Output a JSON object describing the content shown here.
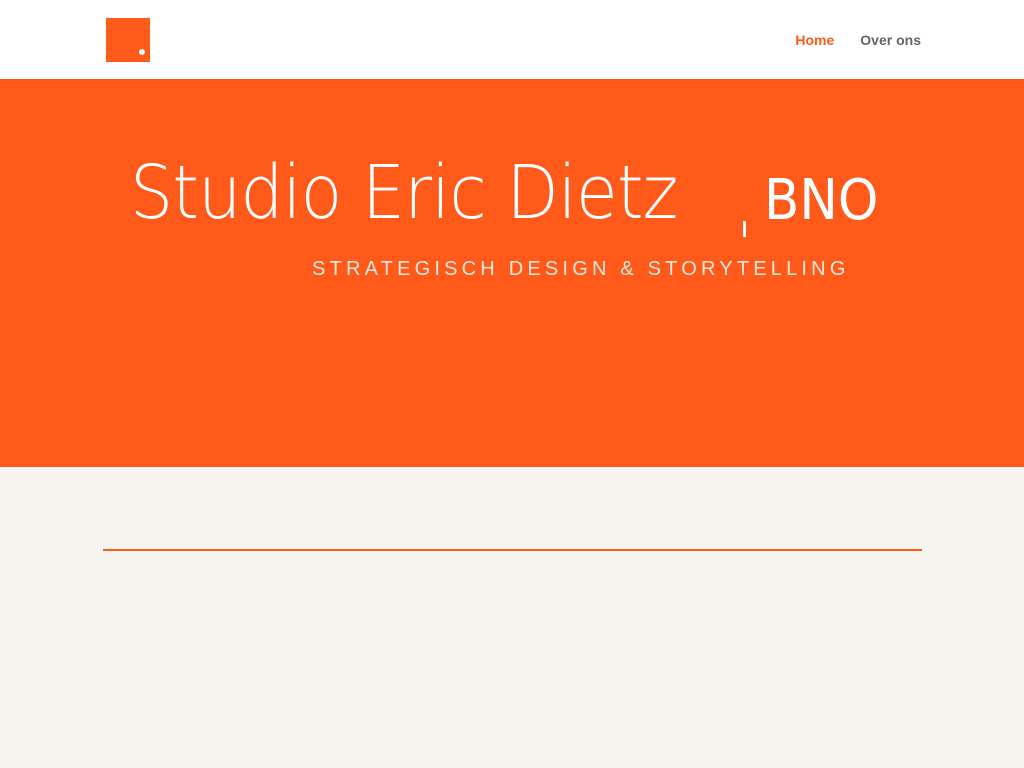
{
  "colors": {
    "brand_orange": "#ff5a1a",
    "page_background": "#f5f4ee",
    "header_background": "#ffffff",
    "nav_text": "#666666"
  },
  "header": {
    "logo_icon": "orange-square-dot-logo",
    "nav": [
      {
        "label": "Home",
        "active": true
      },
      {
        "label": "Over ons",
        "active": false
      }
    ]
  },
  "hero": {
    "title": "Studio Eric Dietz",
    "separator": ",",
    "suffix": "BNO",
    "subtitle": "STRATEGISCH DESIGN & STORYTELLING"
  }
}
